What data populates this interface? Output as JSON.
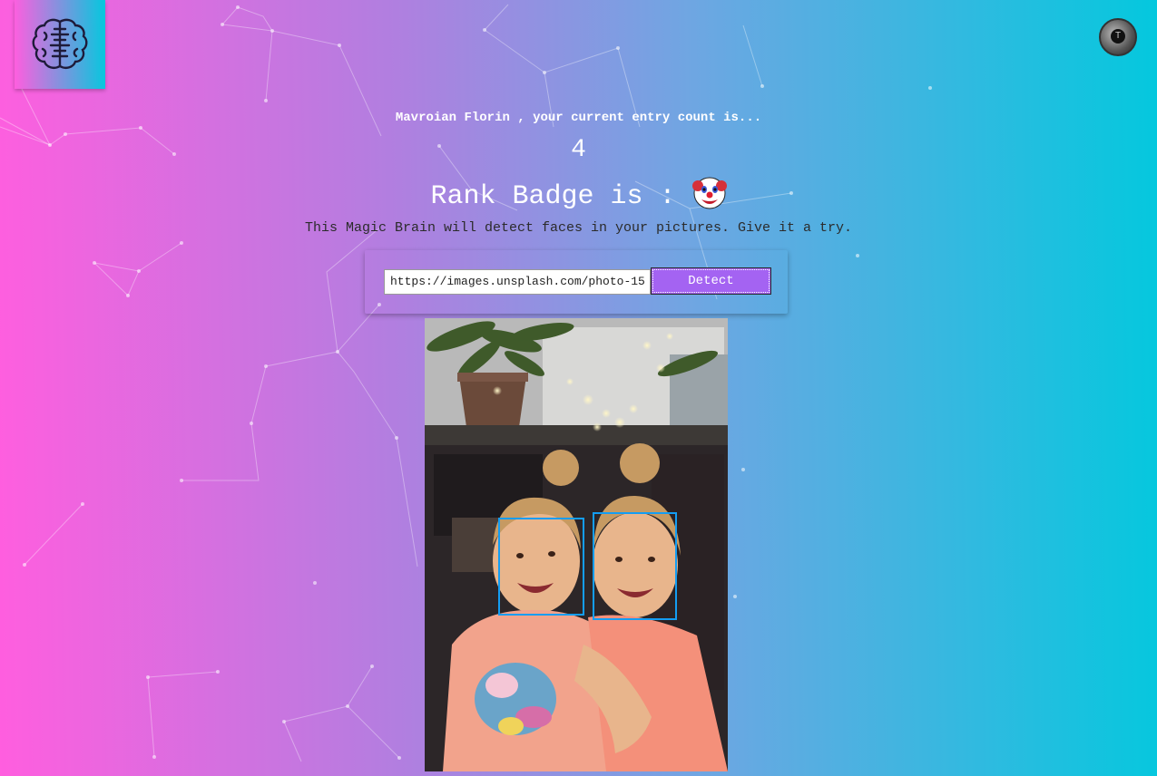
{
  "header": {
    "logo_icon": "brain-icon",
    "avatar_icon": "user-avatar"
  },
  "entry": {
    "prefix_name": "Mavroian Florin",
    "suffix": " , your current entry count is...",
    "count": "4"
  },
  "rank": {
    "label": "Rank Badge is : ",
    "badge_icon": "clown-face-icon"
  },
  "description": "This Magic Brain will detect faces in your pictures. Give it a try.",
  "form": {
    "input_value": "https://images.unsplash.com/photo-15",
    "detect_label": "Detect"
  },
  "image": {
    "subject": "two-smiling-girls-hugging",
    "detected_faces": 2
  },
  "colors": {
    "gradient_left": "#ff5edf",
    "gradient_right": "#04c8de",
    "button": "#a463f2",
    "face_box": "#149df2"
  }
}
